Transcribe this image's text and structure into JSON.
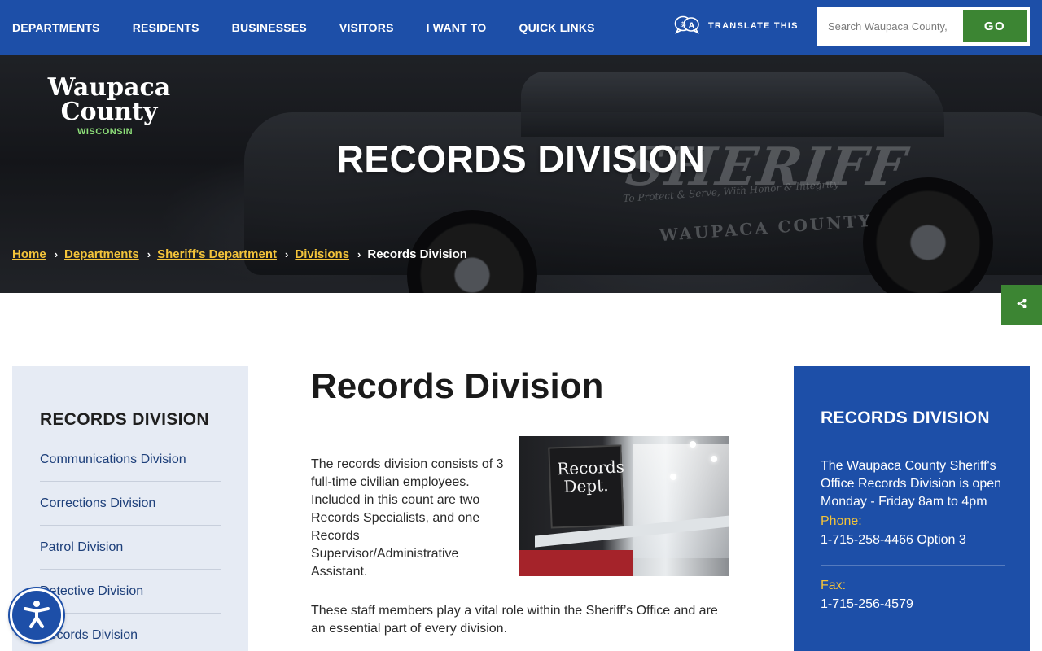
{
  "nav": {
    "items": [
      "DEPARTMENTS",
      "RESIDENTS",
      "BUSINESSES",
      "VISITORS",
      "I WANT TO",
      "QUICK LINKS"
    ],
    "translate_label": "TRANSLATE THIS",
    "search_placeholder": "Search Waupaca County,",
    "search_button": "GO"
  },
  "logo": {
    "line1": "Waupaca",
    "line2": "County",
    "state": "WISCONSIN"
  },
  "hero": {
    "title": "RECORDS DIVISION",
    "photo_text": {
      "sheriff": "SHERIFF",
      "motto": "To Protect & Serve, With Honor & Integrity",
      "county": "WAUPACA COUNTY"
    }
  },
  "breadcrumb": {
    "links": [
      "Home",
      "Departments",
      "Sheriff's Department",
      "Divisions"
    ],
    "separator": "›",
    "current": "Records Division"
  },
  "sidebar": {
    "title": "RECORDS DIVISION",
    "items": [
      "Communications Division",
      "Corrections Division",
      "Patrol Division",
      "Detective Division",
      "Records Division"
    ]
  },
  "main": {
    "title": "Records Division",
    "paragraph1": "The records division consists of 3 full-time civilian employees. Included in this count are two Records Specialists, and one Records Supervisor/Administrative Assistant.",
    "image_sign": "Records Dept.",
    "paragraph2": "These staff members play a vital role within the Sheriff’s Office and are an essential part of every division."
  },
  "infobox": {
    "title": "RECORDS DIVISION",
    "hours": "The Waupaca County Sheriff's Office Records Division is open Monday - Friday 8am to 4pm",
    "phone_label": "Phone:",
    "phone": "1-715-258-4466 Option 3",
    "fax_label": "Fax:",
    "fax": "1-715-256-4579"
  },
  "colors": {
    "primary_blue": "#1d4fa8",
    "accent_green": "#3c8533",
    "link_gold": "#f3c33a",
    "sidebar_bg": "#e6ebf4"
  },
  "icons": {
    "translate": "translate-icon",
    "share": "share-icon",
    "accessibility": "accessibility-icon",
    "breadcrumb_sep": "chevron-right-icon"
  }
}
